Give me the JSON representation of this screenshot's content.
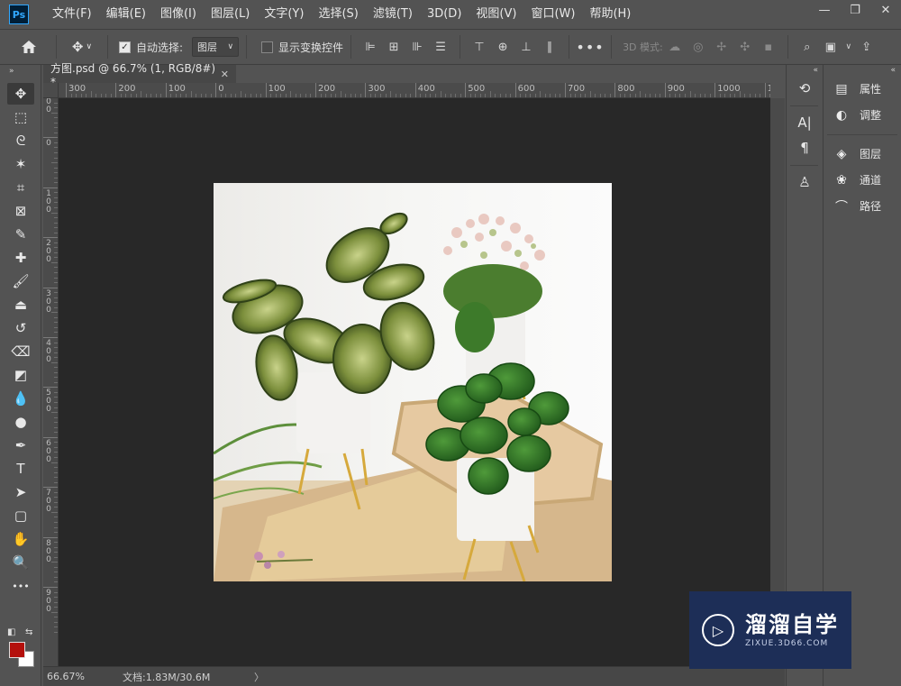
{
  "app": {
    "logo_text": "Ps",
    "menu": [
      "文件(F)",
      "编辑(E)",
      "图像(I)",
      "图层(L)",
      "文字(Y)",
      "选择(S)",
      "滤镜(T)",
      "3D(D)",
      "视图(V)",
      "窗口(W)",
      "帮助(H)"
    ],
    "window_controls": {
      "minimize": "—",
      "restore": "❐",
      "close": "✕"
    }
  },
  "options": {
    "auto_select_label": "自动选择:",
    "auto_select_checked": true,
    "layer_select_value": "图层",
    "show_transform_label": "显示变换控件",
    "show_transform_checked": false,
    "more_label": "•••",
    "mode_3d_label": "3D 模式:"
  },
  "document": {
    "tab_title": "方图.psd @ 66.7% (1, RGB/8#) *",
    "tab_close": "✕",
    "ruler_h_labels": [
      "300",
      "200",
      "100",
      "0",
      "100",
      "200",
      "300",
      "400",
      "500",
      "600",
      "700",
      "800",
      "900",
      "1000",
      "1"
    ],
    "ruler_v_labels": [
      "1\n0\n0",
      "0",
      "1\n0\n0",
      "2\n0\n0",
      "3\n0\n0",
      "4\n0\n0",
      "5\n0\n0",
      "6\n0\n0",
      "7\n0\n0",
      "8\n0\n0",
      "9\n0\n0"
    ],
    "zoom": "66.67%",
    "doc_info": "文档:1.83M/30.6M",
    "status_arrow": "〉"
  },
  "tools": [
    {
      "name": "move-tool",
      "glyph": "✥",
      "active": true
    },
    {
      "name": "marquee-tool",
      "glyph": "⬚"
    },
    {
      "name": "lasso-tool",
      "glyph": "ᘓ"
    },
    {
      "name": "magic-wand-tool",
      "glyph": "✶"
    },
    {
      "name": "crop-tool",
      "glyph": "⌗"
    },
    {
      "name": "frame-tool",
      "glyph": "⊠"
    },
    {
      "name": "eyedropper-tool",
      "glyph": "✎"
    },
    {
      "name": "healing-brush-tool",
      "glyph": "✚"
    },
    {
      "name": "brush-tool",
      "glyph": "🖌"
    },
    {
      "name": "clone-stamp-tool",
      "glyph": "⏏"
    },
    {
      "name": "history-brush-tool",
      "glyph": "↺"
    },
    {
      "name": "eraser-tool",
      "glyph": "⌫"
    },
    {
      "name": "paint-bucket-tool",
      "glyph": "◩"
    },
    {
      "name": "blur-tool",
      "glyph": "💧"
    },
    {
      "name": "dodge-tool",
      "glyph": "●"
    },
    {
      "name": "pen-tool",
      "glyph": "✒"
    },
    {
      "name": "type-tool",
      "glyph": "T"
    },
    {
      "name": "path-selection-tool",
      "glyph": "➤"
    },
    {
      "name": "rectangle-tool",
      "glyph": "▢"
    },
    {
      "name": "hand-tool",
      "glyph": "✋"
    },
    {
      "name": "zoom-tool",
      "glyph": "🔍"
    },
    {
      "name": "edit-toolbar",
      "glyph": "•••"
    }
  ],
  "colors": {
    "foreground": "#b4100c",
    "background": "#ffffff"
  },
  "panel_strip": [
    {
      "name": "history-panel-icon",
      "glyph": "⟲"
    },
    {
      "name": "character-panel-icon",
      "glyph": "A|"
    },
    {
      "name": "paragraph-panel-icon",
      "glyph": "¶"
    },
    {
      "name": "clone-source-panel-icon",
      "glyph": "♙"
    }
  ],
  "panels": [
    {
      "name": "properties",
      "label": "属性",
      "glyph": "▤"
    },
    {
      "name": "adjustments",
      "label": "调整",
      "glyph": "◐"
    },
    {
      "name": "layers",
      "label": "图层",
      "glyph": "◈"
    },
    {
      "name": "channels",
      "label": "通道",
      "glyph": "❀"
    },
    {
      "name": "paths",
      "label": "路径",
      "glyph": "⌒"
    }
  ],
  "watermark": {
    "brand": "溜溜自学",
    "url": "ZIXUE.3D66.COM"
  }
}
